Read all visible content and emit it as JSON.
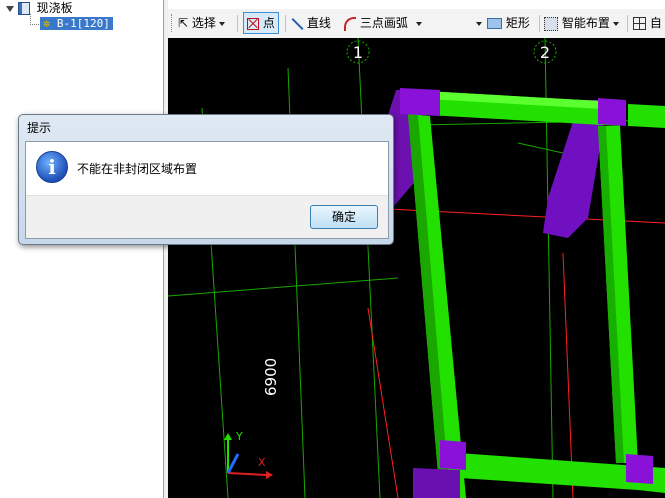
{
  "tree": {
    "root_label": "现浇板",
    "child_label": "B-1[120]"
  },
  "toolbar": {
    "select_label": "选择",
    "point_label": "点",
    "line_label": "直线",
    "arc_label": "三点画弧",
    "rect_label": "矩形",
    "smart_label": "智能布置",
    "cut_label": "自"
  },
  "canvas": {
    "axis_label_1": "1",
    "axis_label_2": "2",
    "dimension_text": "6900",
    "ucs_y": "Y",
    "ucs_x": "X",
    "colors": {
      "column": "#8a12d8",
      "beam": "#22e000",
      "grid_red": "#ff2020",
      "grid_green": "#19a600"
    }
  },
  "dialog": {
    "title": "提示",
    "message": "不能在非封闭区域布置",
    "ok_label": "确定",
    "icon": "info-icon"
  }
}
